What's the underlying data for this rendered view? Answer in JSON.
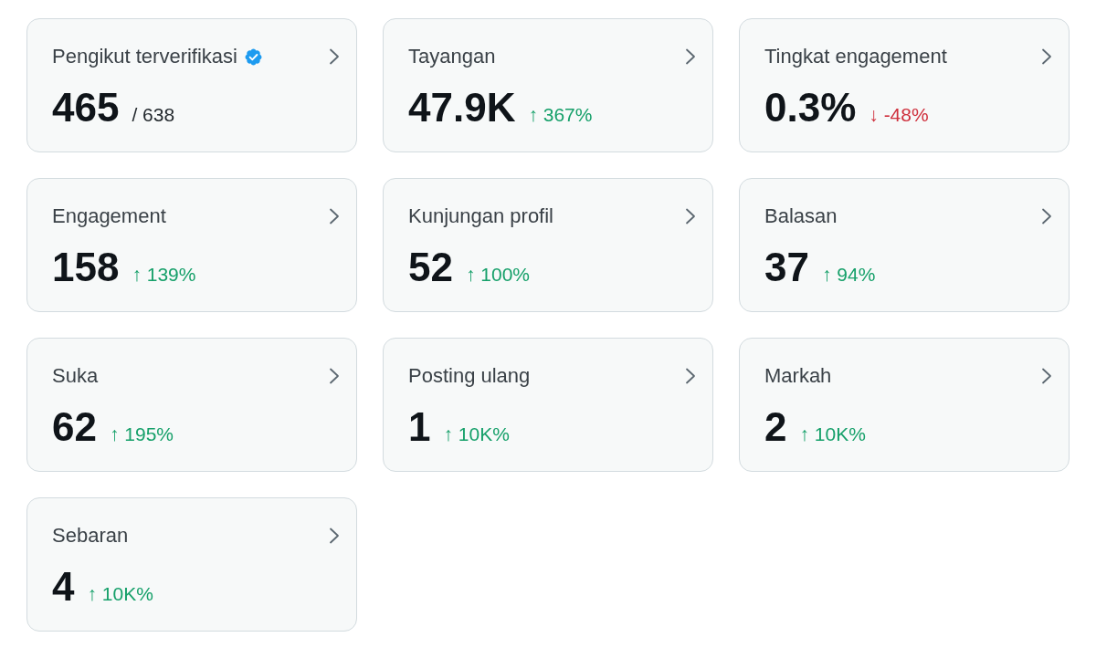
{
  "cards": [
    {
      "label": "Pengikut terverifikasi",
      "verified": true,
      "value": "465",
      "total": "/ 638"
    },
    {
      "label": "Tayangan",
      "verified": false,
      "value": "47.9K",
      "change": "↑ 367%",
      "positive": true
    },
    {
      "label": "Tingkat engagement",
      "verified": false,
      "value": "0.3%",
      "change": "↓ -48%",
      "positive": false
    },
    {
      "label": "Engagement",
      "verified": false,
      "value": "158",
      "change": "↑ 139%",
      "positive": true
    },
    {
      "label": "Kunjungan profil",
      "verified": false,
      "value": "52",
      "change": "↑ 100%",
      "positive": true
    },
    {
      "label": "Balasan",
      "verified": false,
      "value": "37",
      "change": "↑ 94%",
      "positive": true
    },
    {
      "label": "Suka",
      "verified": false,
      "value": "62",
      "change": "↑ 195%",
      "positive": true
    },
    {
      "label": "Posting ulang",
      "verified": false,
      "value": "1",
      "change": "↑ 10K%",
      "positive": true
    },
    {
      "label": "Markah",
      "verified": false,
      "value": "2",
      "change": "↑ 10K%",
      "positive": true
    },
    {
      "label": "Sebaran",
      "verified": false,
      "value": "4",
      "change": "↑ 10K%",
      "positive": true
    }
  ]
}
